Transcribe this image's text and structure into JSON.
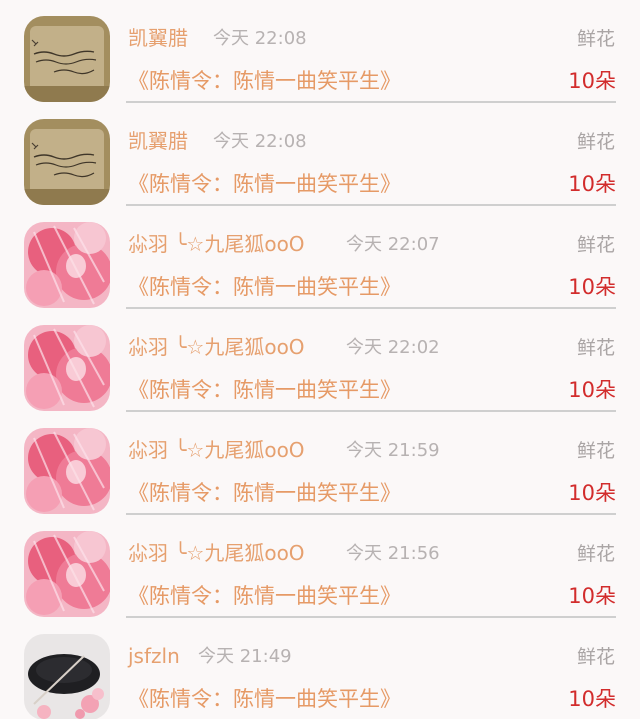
{
  "items": [
    {
      "user": "凯翼腊",
      "time": "今天 22:08",
      "gift": "鲜花",
      "title": "《陈情令：陈情一曲笑平生》",
      "count": "10朵",
      "avatar": "paper-note"
    },
    {
      "user": "凯翼腊",
      "time": "今天 22:08",
      "gift": "鲜花",
      "title": "《陈情令：陈情一曲笑平生》",
      "count": "10朵",
      "avatar": "paper-note"
    },
    {
      "user": "尛羽 ╰☆九尾狐ooO",
      "time": "今天 22:07",
      "gift": "鲜花",
      "title": "《陈情令：陈情一曲笑平生》",
      "count": "10朵",
      "avatar": "pink-anime"
    },
    {
      "user": "尛羽 ╰☆九尾狐ooO",
      "time": "今天 22:02",
      "gift": "鲜花",
      "title": "《陈情令：陈情一曲笑平生》",
      "count": "10朵",
      "avatar": "pink-anime"
    },
    {
      "user": "尛羽 ╰☆九尾狐ooO",
      "time": "今天 21:59",
      "gift": "鲜花",
      "title": "《陈情令：陈情一曲笑平生》",
      "count": "10朵",
      "avatar": "pink-anime"
    },
    {
      "user": "尛羽 ╰☆九尾狐ooO",
      "time": "今天 21:56",
      "gift": "鲜花",
      "title": "《陈情令：陈情一曲笑平生》",
      "count": "10朵",
      "avatar": "pink-anime"
    },
    {
      "user": "jsfzln",
      "time": "今天 21:49",
      "gift": "鲜花",
      "title": "《陈情令：陈情一曲笑平生》",
      "count": "10朵",
      "avatar": "plate-flowers"
    }
  ],
  "colors": {
    "background": "#fbf8f8",
    "username": "#e6a06f",
    "time": "#b7b2b2",
    "gift": "#aaa5a5",
    "title": "#e69a66",
    "count": "#d22c2c",
    "divider": "#cfcfcf"
  }
}
